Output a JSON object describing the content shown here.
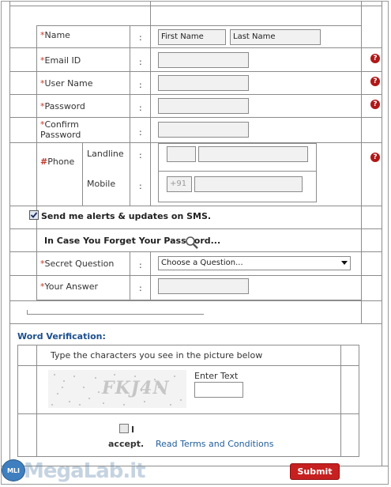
{
  "form": {
    "first_name_placeholder": "First Name",
    "last_name_placeholder": "Last Name",
    "required_mark": "*",
    "phone_mark": "#",
    "colon": ":",
    "help_glyph": "?",
    "labels": {
      "name": "Name",
      "email": "Email ID",
      "username": "User Name",
      "password": "Password",
      "confirm_password_l1": "Confirm",
      "confirm_password_l2": "Password",
      "phone": "Phone",
      "landline": "Landline",
      "mobile": "Mobile",
      "secret_question": "Secret Question",
      "your_answer": "Your Answer"
    },
    "mobile_prefix": "+91",
    "sms_alerts_label": "Send me alerts & updates on SMS.",
    "sms_alerts_checked": true,
    "forget_password_heading": "In Case You Forget Your Password...",
    "secret_question_selected": "Choose a Question..."
  },
  "verification": {
    "title": "Word Verification:",
    "instruction": "Type the characters you see in the picture below",
    "captcha_text": "FKJ4N",
    "enter_text_label": "Enter Text",
    "accept_label_l1": "I",
    "accept_label_l2": "accept.",
    "terms_link": "Read Terms and Conditions",
    "submit_label": "Submit"
  },
  "watermark": {
    "brand": "MegaLab.it",
    "badge": "MLI"
  },
  "colors": {
    "required": "#c0392b",
    "help_icon": "#b01818",
    "link": "#1f5d99",
    "submit": "#c62020",
    "section_title": "#1d4f8c"
  }
}
